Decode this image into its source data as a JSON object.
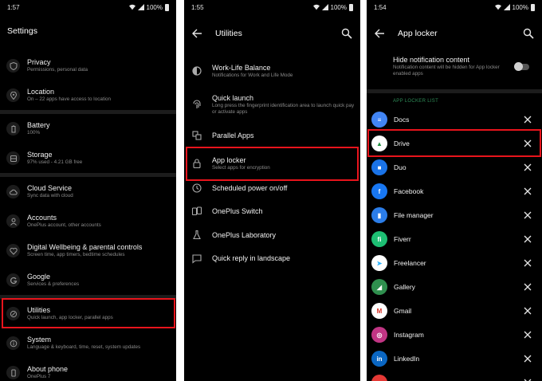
{
  "colors": {
    "highlight": "#e8141c",
    "accent_green": "#2e8b57",
    "panel_bg": "#000000"
  },
  "panel1": {
    "status": {
      "time": "1:57",
      "battery": "100%"
    },
    "title": "Settings",
    "items": [
      {
        "title": "Privacy",
        "subtitle": "Permissions, personal data",
        "icon": "shield-icon"
      },
      {
        "title": "Location",
        "subtitle": "On – 22 apps have access to location",
        "icon": "location-pin-icon"
      },
      {
        "title": "Battery",
        "subtitle": "100%",
        "icon": "battery-icon"
      },
      {
        "title": "Storage",
        "subtitle": "97% used - 4.21 GB free",
        "icon": "storage-icon"
      },
      {
        "title": "Cloud Service",
        "subtitle": "Sync data with cloud",
        "icon": "cloud-icon"
      },
      {
        "title": "Accounts",
        "subtitle": "OnePlus account, other accounts",
        "icon": "person-icon"
      },
      {
        "title": "Digital Wellbeing & parental controls",
        "subtitle": "Screen time, app timers, bedtime schedules",
        "icon": "heart-icon"
      },
      {
        "title": "Google",
        "subtitle": "Services & preferences",
        "icon": "google-icon"
      },
      {
        "title": "Utilities",
        "subtitle": "Quick launch, app locker, parallel apps",
        "icon": "utilities-icon"
      },
      {
        "title": "System",
        "subtitle": "Language & keyboard, time, reset, system updates",
        "icon": "info-icon"
      },
      {
        "title": "About phone",
        "subtitle": "OnePlus 7",
        "icon": "phone-icon"
      }
    ]
  },
  "panel2": {
    "status": {
      "time": "1:55",
      "battery": "100%"
    },
    "title": "Utilities",
    "items": [
      {
        "title": "Work-Life Balance",
        "subtitle": "Notifications for Work and Life Mode",
        "icon": "balance-icon"
      },
      {
        "title": "Quick launch",
        "subtitle": "Long press the fingerprint identification area to launch quick pay or activate apps",
        "icon": "fingerprint-icon"
      },
      {
        "title": "Parallel Apps",
        "subtitle": "",
        "icon": "parallel-apps-icon"
      },
      {
        "title": "App locker",
        "subtitle": "Select apps for encryption",
        "icon": "lock-icon"
      },
      {
        "title": "Scheduled power on/off",
        "subtitle": "",
        "icon": "clock-icon"
      },
      {
        "title": "OnePlus Switch",
        "subtitle": "",
        "icon": "switch-icon"
      },
      {
        "title": "OnePlus Laboratory",
        "subtitle": "",
        "icon": "flask-icon"
      },
      {
        "title": "Quick reply in landscape",
        "subtitle": "",
        "icon": "chat-icon"
      }
    ]
  },
  "panel3": {
    "status": {
      "time": "1:54",
      "battery": "100%"
    },
    "title": "App locker",
    "hide_notification": {
      "title": "Hide notification content",
      "subtitle": "Notification content will be hidden for App locker enabled apps"
    },
    "section_header": "APP LOCKER LIST",
    "apps": [
      {
        "name": "Docs",
        "icon": "docs-icon",
        "color": "#4285f4"
      },
      {
        "name": "Drive",
        "icon": "drive-icon",
        "color": "#ffffff"
      },
      {
        "name": "Duo",
        "icon": "duo-icon",
        "color": "#1a73e8"
      },
      {
        "name": "Facebook",
        "icon": "facebook-icon",
        "color": "#1877f2"
      },
      {
        "name": "File manager",
        "icon": "file-manager-icon",
        "color": "#2b7de9"
      },
      {
        "name": "Fiverr",
        "icon": "fiverr-icon",
        "color": "#1dbf73"
      },
      {
        "name": "Freelancer",
        "icon": "freelancer-icon",
        "color": "#ffffff"
      },
      {
        "name": "Gallery",
        "icon": "gallery-icon",
        "color": "#2f8f4e"
      },
      {
        "name": "Gmail",
        "icon": "gmail-icon",
        "color": "#ffffff"
      },
      {
        "name": "Instagram",
        "icon": "instagram-icon",
        "color": "#c13584"
      },
      {
        "name": "LinkedIn",
        "icon": "linkedin-icon",
        "color": "#0a66c2"
      },
      {
        "name": "",
        "icon": "app-icon",
        "color": "#e53935"
      }
    ]
  }
}
